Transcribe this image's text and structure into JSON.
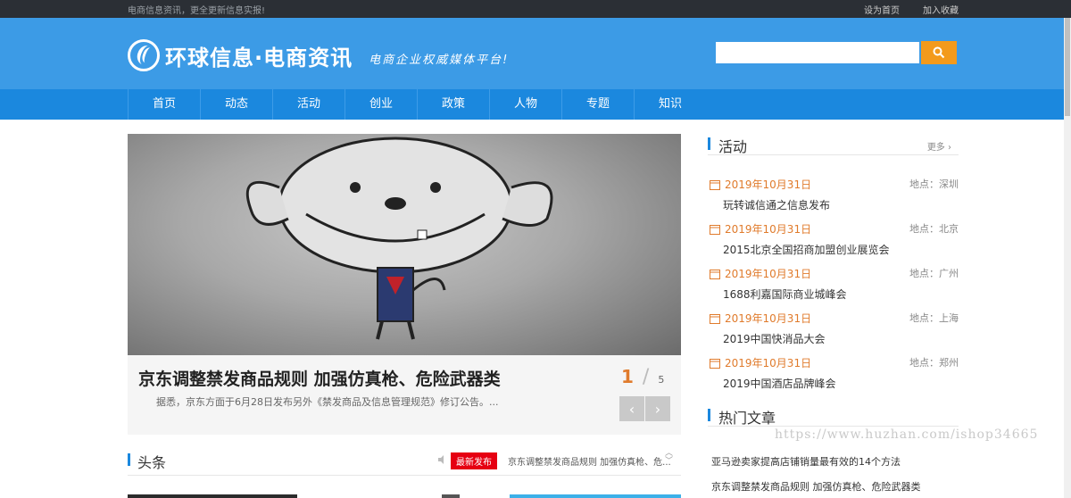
{
  "topbar": {
    "slogan": "电商信息资讯，更全更新信息实报!",
    "set_home": "设为首页",
    "add_fav": "加入收藏"
  },
  "header": {
    "logo_text": "环球信息·电商资讯",
    "logo_sub": "电商企业权威媒体平台!",
    "search_placeholder": "",
    "colors": {
      "header_bg": "#3c9be6",
      "nav_bg": "#1b88de",
      "search_btn": "#f39a1c",
      "accent_orange": "#e07b2c"
    }
  },
  "nav": {
    "items": [
      "首页",
      "动态",
      "活动",
      "创业",
      "政策",
      "人物",
      "专题",
      "知识"
    ]
  },
  "slider": {
    "title": "京东调整禁发商品规则 加强仿真枪、危险武器类",
    "desc": "据悉，京东方面于6月28日发布另外《禁发商品及信息管理规范》修订公告。...",
    "current": "1",
    "separator": "/",
    "total": "5",
    "prev_icon": "chevron-left-icon",
    "next_icon": "chevron-right-icon"
  },
  "headline": {
    "title": "头条",
    "badge": "最新发布",
    "news": "京东调整禁发商品规则 加强仿真枪、危..."
  },
  "events": {
    "title": "活动",
    "more": "更多 ›",
    "items": [
      {
        "date": "2019年10月31日",
        "location": "地点：深圳",
        "name": "玩转诚信通之信息发布"
      },
      {
        "date": "2019年10月31日",
        "location": "地点：北京",
        "name": "2015北京全国招商加盟创业展览会"
      },
      {
        "date": "2019年10月31日",
        "location": "地点：广州",
        "name": "1688利嘉国际商业城峰会"
      },
      {
        "date": "2019年10月31日",
        "location": "地点：上海",
        "name": "2019中国快消品大会"
      },
      {
        "date": "2019年10月31日",
        "location": "地点：郑州",
        "name": "2019中国酒店品牌峰会"
      }
    ]
  },
  "hot": {
    "title": "热门文章",
    "items": [
      "亚马逊卖家提高店铺销量最有效的14个方法",
      "京东调整禁发商品规则 加强仿真枪、危险武器类"
    ]
  },
  "watermark": "https://www.huzhan.com/ishop34665"
}
